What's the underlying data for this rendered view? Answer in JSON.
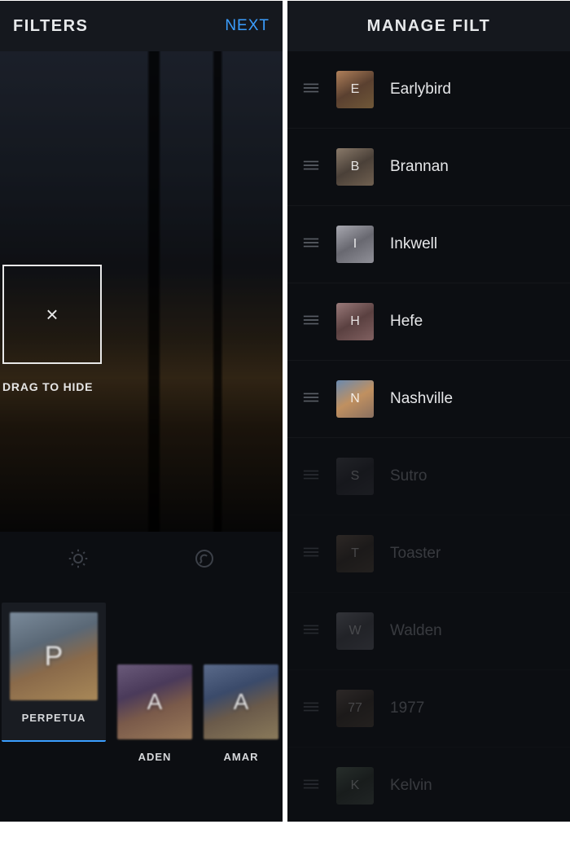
{
  "left": {
    "header": {
      "title": "FILTERS",
      "next_label": "NEXT"
    },
    "drop_hint": "DRAG TO HIDE",
    "drop_icon": "×",
    "filters": [
      {
        "key": "P",
        "label": "PERPETUA",
        "thumb_class": "thumb-perpetua",
        "lifted": true
      },
      {
        "key": "A",
        "label": "ADEN",
        "thumb_class": "thumb-aden",
        "lifted": false
      },
      {
        "key": "A",
        "label": "AMAR",
        "thumb_class": "thumb-amaro",
        "lifted": false
      }
    ]
  },
  "right": {
    "header": {
      "title": "MANAGE FILT"
    },
    "rows": [
      {
        "key": "E",
        "label": "Earlybird",
        "thumb_class": "mt-e",
        "dim": false
      },
      {
        "key": "B",
        "label": "Brannan",
        "thumb_class": "mt-b",
        "dim": false
      },
      {
        "key": "I",
        "label": "Inkwell",
        "thumb_class": "mt-i",
        "dim": false
      },
      {
        "key": "H",
        "label": "Hefe",
        "thumb_class": "mt-h",
        "dim": false
      },
      {
        "key": "N",
        "label": "Nashville",
        "thumb_class": "mt-n",
        "dim": false
      },
      {
        "key": "S",
        "label": "Sutro",
        "thumb_class": "mt-s",
        "dim": true
      },
      {
        "key": "T",
        "label": "Toaster",
        "thumb_class": "mt-t",
        "dim": true
      },
      {
        "key": "W",
        "label": "Walden",
        "thumb_class": "mt-w",
        "dim": true
      },
      {
        "key": "77",
        "label": "1977",
        "thumb_class": "mt-77",
        "dim": true
      },
      {
        "key": "K",
        "label": "Kelvin",
        "thumb_class": "mt-k",
        "dim": true
      }
    ]
  }
}
